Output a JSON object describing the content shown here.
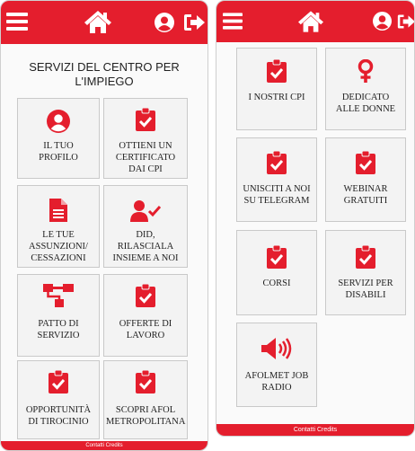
{
  "colors": {
    "accent": "#e41e2d",
    "tile_bg": "#f3f3f3",
    "text": "#222222"
  },
  "left_screen": {
    "nav_icons": [
      "menu-icon",
      "home-icon",
      "user-circle-icon",
      "logout-icon"
    ],
    "heading": "SERVIZI DEL CENTRO PER L'IMPIEGO",
    "tiles": [
      {
        "icon": "user-circle-icon",
        "lines": [
          "IL TUO",
          "PROFILO"
        ]
      },
      {
        "icon": "clipboard-check-icon",
        "lines": [
          "OTTIENI UN",
          "CERTIFICATO",
          "DAI CPI"
        ]
      },
      {
        "icon": "document-icon",
        "lines": [
          "LE TUE",
          "ASSUNZIONI/",
          "CESSAZIONI"
        ]
      },
      {
        "icon": "user-check-icon",
        "lines": [
          "DID,",
          "RILASCIALA",
          "INSIEME A NOI"
        ]
      },
      {
        "icon": "sitemap-icon",
        "lines": [
          "PATTO DI",
          "SERVIZIO"
        ]
      },
      {
        "icon": "clipboard-check-icon",
        "lines": [
          "OFFERTE DI",
          "LAVORO"
        ]
      },
      {
        "icon": "clipboard-check-icon",
        "lines": [
          "OPPORTUNITÀ",
          "DI TIROCINIO"
        ]
      },
      {
        "icon": "clipboard-check-icon",
        "lines": [
          "SCOPRI AFOL",
          "METROPOLITANA"
        ]
      }
    ],
    "footer": "Contatti Credits"
  },
  "right_screen": {
    "nav_icons": [
      "menu-icon",
      "home-icon",
      "user-circle-icon",
      "logout-icon"
    ],
    "tiles": [
      {
        "icon": "clipboard-check-icon",
        "lines": [
          "I NOSTRI CPI"
        ]
      },
      {
        "icon": "female-icon",
        "lines": [
          "DEDICATO",
          "ALLE DONNE"
        ]
      },
      {
        "icon": "clipboard-check-icon",
        "lines": [
          "UNISCITI A NOI",
          "SU TELEGRAM"
        ]
      },
      {
        "icon": "clipboard-check-icon",
        "lines": [
          "WEBINAR",
          "GRATUITI"
        ]
      },
      {
        "icon": "clipboard-check-icon",
        "lines": [
          "CORSI"
        ]
      },
      {
        "icon": "clipboard-check-icon",
        "lines": [
          "SERVIZI PER",
          "DISABILI"
        ]
      },
      {
        "icon": "volume-icon",
        "lines": [
          "AFOLMET JOB",
          "RADIO"
        ]
      }
    ],
    "footer": "Contatti Credits"
  }
}
